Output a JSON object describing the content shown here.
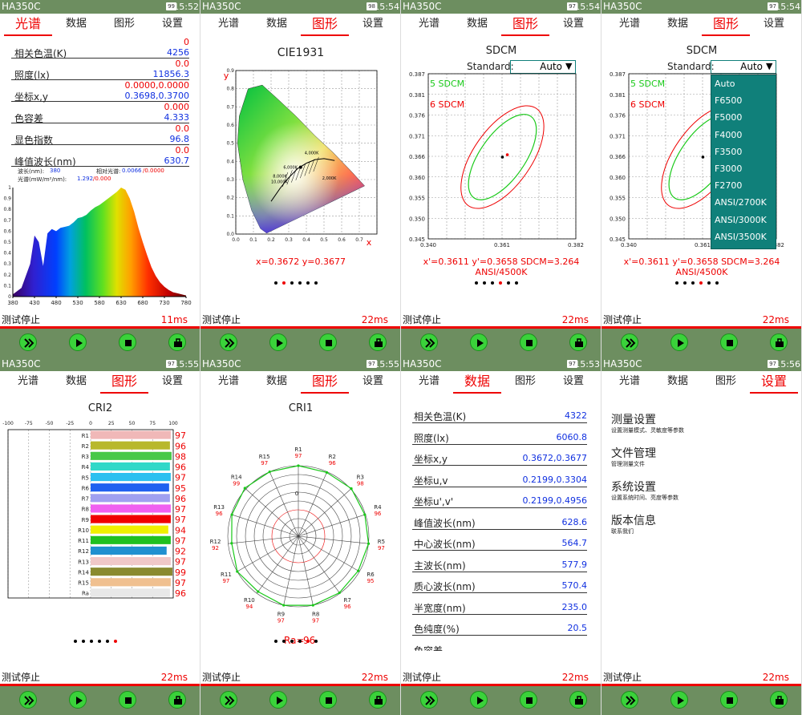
{
  "app": "HA350C",
  "tabs": [
    "光谱",
    "数据",
    "图形",
    "设置"
  ],
  "stop_label": "测试停止",
  "icons": {
    "fast": "fast-forward-icon",
    "play": "play-icon",
    "stop": "stop-icon",
    "export": "export-icon"
  },
  "colors": {
    "bar": "#6d8e60",
    "accent": "#e00000",
    "value": "#1030e0",
    "btn": "#3ad23a"
  },
  "panels": [
    {
      "battery": "99",
      "time": "15:52",
      "active_tab": 0,
      "time_ms": "11ms"
    },
    {
      "battery": "98",
      "time": "15:54",
      "active_tab": 2,
      "time_ms": "22ms"
    },
    {
      "battery": "97",
      "time": "15:54",
      "active_tab": 2,
      "time_ms": "22ms"
    },
    {
      "battery": "97",
      "time": "15:54",
      "active_tab": 2,
      "time_ms": "22ms"
    },
    {
      "battery": "97",
      "time": "15:55",
      "active_tab": 2,
      "time_ms": "22ms"
    },
    {
      "battery": "97",
      "time": "15:55",
      "active_tab": 2,
      "time_ms": "22ms"
    },
    {
      "battery": "97",
      "time": "15:53",
      "active_tab": 1,
      "time_ms": "22ms"
    },
    {
      "battery": "97",
      "time": "15:56",
      "active_tab": 3,
      "time_ms": "22ms"
    }
  ],
  "spectrum": {
    "rows": [
      {
        "label": "相关色温(K)",
        "red": "0",
        "val": "4256"
      },
      {
        "label": "照度(lx)",
        "red": "0.0",
        "val": "11856.3"
      },
      {
        "label": "坐标x,y",
        "red": "0.0000,0.0000",
        "val": "0.3698,0.3700"
      },
      {
        "label": "色容差",
        "red": "0.000",
        "val": "4.333"
      },
      {
        "label": "显色指数",
        "red": "0.0",
        "val": "96.8"
      },
      {
        "label": "峰值波长(nm)",
        "red": "0.0",
        "val": "630.7"
      }
    ],
    "cursor": {
      "wl_label": "波长(nm):",
      "wl": "380",
      "rel_label": "相对光谱:",
      "rel": "0.0066",
      "rel_red": "/0.0000",
      "sp_label": "光谱(mW/m²/nm):",
      "sp": "1.292",
      "sp_red": "/0.000"
    },
    "chart_data": {
      "type": "area",
      "x": [
        380,
        400,
        420,
        430,
        440,
        450,
        460,
        470,
        480,
        490,
        500,
        510,
        520,
        530,
        540,
        550,
        560,
        570,
        580,
        590,
        600,
        610,
        620,
        630,
        640,
        650,
        660,
        670,
        680,
        690,
        700,
        710,
        720,
        730,
        740,
        750,
        760,
        770,
        780
      ],
      "y": [
        0.02,
        0.08,
        0.3,
        0.56,
        0.5,
        0.28,
        0.58,
        0.62,
        0.6,
        0.63,
        0.64,
        0.65,
        0.68,
        0.72,
        0.73,
        0.75,
        0.79,
        0.82,
        0.84,
        0.87,
        0.9,
        0.93,
        0.96,
        1.0,
        0.98,
        0.9,
        0.78,
        0.63,
        0.5,
        0.38,
        0.27,
        0.19,
        0.13,
        0.09,
        0.06,
        0.04,
        0.03,
        0.02,
        0.01
      ],
      "xticks": [
        "380",
        "430",
        "480",
        "530",
        "580",
        "630",
        "680",
        "730",
        "780"
      ],
      "yticks": [
        "0",
        "0.1",
        "0.2",
        "0.3",
        "0.4",
        "0.5",
        "0.6",
        "0.7",
        "0.8",
        "0.9",
        "1"
      ],
      "xlim": [
        380,
        780
      ],
      "ylim": [
        0,
        1
      ]
    }
  },
  "cie": {
    "title": "CIE1931",
    "x_axis": "x",
    "y_axis": "y",
    "readout": "x=0.3672  y=0.3677",
    "xticks": [
      "0.0",
      "0.1",
      "0.2",
      "0.3",
      "0.4",
      "0.5",
      "0.6",
      "0.7"
    ],
    "yticks": [
      "0.0",
      "0.1",
      "0.2",
      "0.3",
      "0.4",
      "0.5",
      "0.6",
      "0.7",
      "0.8",
      "0.9"
    ],
    "cct": [
      "10,000K",
      "8,000K",
      "6,000K",
      "4,000K",
      "2,000K"
    ],
    "chart_data": {
      "type": "scatter",
      "points": [
        {
          "x": 0.3672,
          "y": 0.3677
        }
      ],
      "xlim": [
        0,
        0.8
      ],
      "ylim": [
        0,
        0.9
      ]
    }
  },
  "sdcm": {
    "title": "SDCM",
    "standard_label": "Standard:",
    "standard_value": "Auto",
    "ellipse5": "5 SDCM",
    "ellipse6": "6 SDCM",
    "yticks": [
      "0.387",
      "0.381",
      "0.376",
      "0.371",
      "0.366",
      "0.360",
      "0.355",
      "0.350",
      "0.345"
    ],
    "xticks": [
      "0.340",
      "0.361",
      "0.382"
    ],
    "readout": "x'=0.3611 y'=0.3658  SDCM=3.264",
    "standard": "ANSI/4500K",
    "options": [
      "Auto",
      "F6500",
      "F5000",
      "F4000",
      "F3500",
      "F3000",
      "F2700",
      "ANSI/2700K",
      "ANSI/3000K",
      "ANSI/3500K"
    ],
    "chart_data": {
      "type": "scatter",
      "points": [
        {
          "name": "center",
          "x": 0.3611,
          "y": 0.3658
        },
        {
          "name": "measured",
          "x": 0.3625,
          "y": 0.3664
        }
      ],
      "xlim": [
        0.34,
        0.382
      ],
      "ylim": [
        0.345,
        0.387
      ]
    }
  },
  "cri2": {
    "title": "CRI2",
    "xticks": [
      "-100",
      "-75",
      "-50",
      "-25",
      "0",
      "25",
      "50",
      "75",
      "100"
    ],
    "chart_data": {
      "type": "bar",
      "categories": [
        "R1",
        "R2",
        "R3",
        "R4",
        "R5",
        "R6",
        "R7",
        "R8",
        "R9",
        "R10",
        "R11",
        "R12",
        "R13",
        "R14",
        "R15",
        "Ra"
      ],
      "values": [
        97,
        96,
        98,
        96,
        97,
        95,
        96,
        97,
        97,
        94,
        97,
        92,
        97,
        99,
        97,
        96
      ],
      "colors": [
        "#f0b8b8",
        "#b8b82c",
        "#48c848",
        "#30d8c8",
        "#2cc0f0",
        "#2060f0",
        "#a0a0f0",
        "#f060f0",
        "#f00000",
        "#f0f000",
        "#20c020",
        "#2090d0",
        "#f0c8c8",
        "#8a8a30",
        "#f0c090",
        "#e8e8e8"
      ],
      "xlim": [
        -100,
        100
      ]
    }
  },
  "cri1": {
    "title": "CRI1",
    "ra_label": "Ra=",
    "ra": "96",
    "zero": "0",
    "labels": [
      "R1",
      "R2",
      "R3",
      "R4",
      "R5",
      "R6",
      "R7",
      "R8",
      "R9",
      "R10",
      "R11",
      "R12",
      "R13",
      "R14",
      "R15"
    ],
    "chart_data": {
      "type": "line",
      "categories": [
        "R1",
        "R2",
        "R3",
        "R4",
        "R5",
        "R6",
        "R7",
        "R8",
        "R9",
        "R10",
        "R11",
        "R12",
        "R13",
        "R14",
        "R15"
      ],
      "values": [
        97,
        96,
        98,
        96,
        97,
        95,
        96,
        97,
        97,
        94,
        97,
        92,
        96,
        99,
        97
      ]
    }
  },
  "data_table": [
    {
      "label": "相关色温(K)",
      "val": "4322"
    },
    {
      "label": "照度(lx)",
      "val": "6060.8"
    },
    {
      "label": "坐标x,y",
      "val": "0.3672,0.3677"
    },
    {
      "label": "坐标u,v",
      "val": "0.2199,0.3304"
    },
    {
      "label": "坐标u',v'",
      "val": "0.2199,0.4956"
    },
    {
      "label": "峰值波长(nm)",
      "val": "628.6"
    },
    {
      "label": "中心波长(nm)",
      "val": "564.7"
    },
    {
      "label": "主波长(nm)",
      "val": "577.9"
    },
    {
      "label": "质心波长(nm)",
      "val": "570.4"
    },
    {
      "label": "半宽度(nm)",
      "val": "235.0"
    },
    {
      "label": "色纯度(%)",
      "val": "20.5"
    },
    {
      "label": "色容差",
      "val": ""
    }
  ],
  "settings": [
    {
      "title": "测量设置",
      "sub": "设置测量模式、灵敏度等参数"
    },
    {
      "title": "文件管理",
      "sub": "管理测量文件"
    },
    {
      "title": "系统设置",
      "sub": "设置系统时间、亮度等参数"
    },
    {
      "title": "版本信息",
      "sub": "联系我们"
    }
  ]
}
